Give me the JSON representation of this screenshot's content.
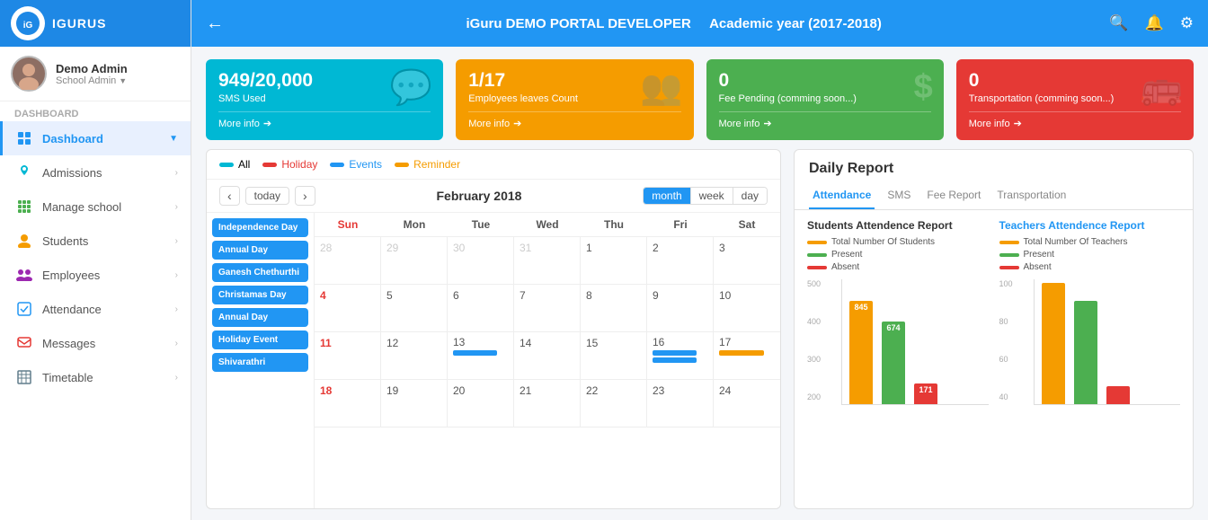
{
  "brand": {
    "name": "IGURUS",
    "logo_alt": "iGuru logo"
  },
  "user": {
    "name": "Demo Admin",
    "role": "School Admin"
  },
  "header": {
    "title": "iGuru DEMO PORTAL DEVELOPER",
    "subtitle": "Academic year (2017-2018)",
    "back_label": "←"
  },
  "stats": [
    {
      "value": "949/20,000",
      "label": "SMS Used",
      "color": "blue",
      "icon": "💬",
      "more": "More info"
    },
    {
      "value": "1/17",
      "label": "Employees leaves Count",
      "color": "orange",
      "icon": "👥",
      "more": "More info"
    },
    {
      "value": "0",
      "label": "Fee Pending (comming soon...)",
      "color": "green",
      "icon": "$",
      "more": "More info"
    },
    {
      "value": "0",
      "label": "Transportation (comming soon...)",
      "color": "red",
      "icon": "🚌",
      "more": "More info"
    }
  ],
  "calendar": {
    "legend": [
      {
        "label": "All",
        "color": "cyan"
      },
      {
        "label": "Holiday",
        "color": "red"
      },
      {
        "label": "Events",
        "color": "blue"
      },
      {
        "label": "Reminder",
        "color": "orange"
      }
    ],
    "month_title": "February 2018",
    "today_btn": "today",
    "views": [
      "month",
      "week",
      "day"
    ],
    "active_view": "month",
    "days_header": [
      "Sun",
      "Mon",
      "Tue",
      "Wed",
      "Thu",
      "Fri",
      "Sat"
    ],
    "events_sidebar": [
      "Independence Day",
      "Annual Day",
      "Ganesh Chethurthi",
      "Christamas Day",
      "Annual Day",
      "Holiday Event",
      "Shivarathri"
    ],
    "weeks": [
      {
        "days": [
          {
            "num": "28",
            "gray": true,
            "events": []
          },
          {
            "num": "29",
            "gray": true,
            "events": []
          },
          {
            "num": "30",
            "gray": true,
            "events": []
          },
          {
            "num": "31",
            "gray": true,
            "events": []
          },
          {
            "num": "1",
            "events": []
          },
          {
            "num": "2",
            "events": []
          },
          {
            "num": "3",
            "events": []
          }
        ]
      },
      {
        "days": [
          {
            "num": "4",
            "red": true,
            "events": []
          },
          {
            "num": "5",
            "events": []
          },
          {
            "num": "6",
            "events": []
          },
          {
            "num": "7",
            "events": []
          },
          {
            "num": "8",
            "events": []
          },
          {
            "num": "9",
            "events": []
          },
          {
            "num": "10",
            "events": []
          }
        ]
      },
      {
        "days": [
          {
            "num": "11",
            "red": true,
            "events": []
          },
          {
            "num": "12",
            "events": []
          },
          {
            "num": "13",
            "events": [
              {
                "label": "",
                "color": "blue"
              }
            ]
          },
          {
            "num": "14",
            "events": []
          },
          {
            "num": "15",
            "events": []
          },
          {
            "num": "16",
            "events": [
              {
                "label": "",
                "color": "blue"
              },
              {
                "label": "",
                "color": "blue"
              }
            ]
          },
          {
            "num": "17",
            "events": [
              {
                "label": "",
                "color": "orange"
              }
            ]
          }
        ]
      },
      {
        "days": [
          {
            "num": "18",
            "red": true,
            "events": []
          },
          {
            "num": "19",
            "events": []
          },
          {
            "num": "20",
            "events": []
          },
          {
            "num": "21",
            "events": []
          },
          {
            "num": "22",
            "events": []
          },
          {
            "num": "23",
            "events": []
          },
          {
            "num": "24",
            "events": []
          }
        ]
      }
    ]
  },
  "daily_report": {
    "title": "Daily Report",
    "tabs": [
      "Attendance",
      "SMS",
      "Fee Report",
      "Transportation"
    ],
    "active_tab": "Attendance",
    "students_section_title": "Students Attendence Report",
    "teachers_section_title": "Teachers Attendence Report",
    "students_legend": [
      {
        "label": "Total Number Of Students",
        "color": "#f59c00"
      },
      {
        "label": "Present",
        "color": "#4caf50"
      },
      {
        "label": "Absent",
        "color": "#e53935"
      }
    ],
    "teachers_legend": [
      {
        "label": "Total Number Of Teachers",
        "color": "#f59c00"
      },
      {
        "label": "Present",
        "color": "#4caf50"
      },
      {
        "label": "Absent",
        "color": "#e53935"
      }
    ],
    "students_bars": [
      {
        "value": 845,
        "color": "#f59c00",
        "label": "845",
        "height_pct": 85
      },
      {
        "value": 674,
        "color": "#4caf50",
        "label": "674",
        "height_pct": 68
      },
      {
        "value": 171,
        "color": "#e53935",
        "label": "171",
        "height_pct": 17
      }
    ],
    "teachers_bars": [
      {
        "value": 100,
        "color": "#f59c00",
        "height_pct": 100,
        "label": ""
      },
      {
        "value": 85,
        "color": "#4caf50",
        "height_pct": 85,
        "label": ""
      },
      {
        "value": 15,
        "color": "#e53935",
        "height_pct": 15,
        "label": ""
      }
    ],
    "y_labels_students": [
      "500",
      "400",
      "300",
      "200"
    ],
    "y_labels_teachers": [
      "100",
      "80",
      "60",
      "40"
    ]
  },
  "sidebar": {
    "section_label": "Dashboard",
    "items": [
      {
        "id": "dashboard",
        "label": "Dashboard",
        "icon": "grid",
        "active": true,
        "has_arrow": true
      },
      {
        "id": "admissions",
        "label": "Admissions",
        "icon": "drop",
        "active": false,
        "has_arrow": true
      },
      {
        "id": "manage-school",
        "label": "Manage school",
        "icon": "apps",
        "active": false,
        "has_arrow": true
      },
      {
        "id": "students",
        "label": "Students",
        "icon": "person",
        "active": false,
        "has_arrow": true
      },
      {
        "id": "employees",
        "label": "Employees",
        "icon": "people",
        "active": false,
        "has_arrow": true
      },
      {
        "id": "attendance",
        "label": "Attendance",
        "icon": "check",
        "active": false,
        "has_arrow": true
      },
      {
        "id": "messages",
        "label": "Messages",
        "icon": "chat",
        "active": false,
        "has_arrow": true
      },
      {
        "id": "timetable",
        "label": "Timetable",
        "icon": "table",
        "active": false,
        "has_arrow": true
      }
    ]
  }
}
